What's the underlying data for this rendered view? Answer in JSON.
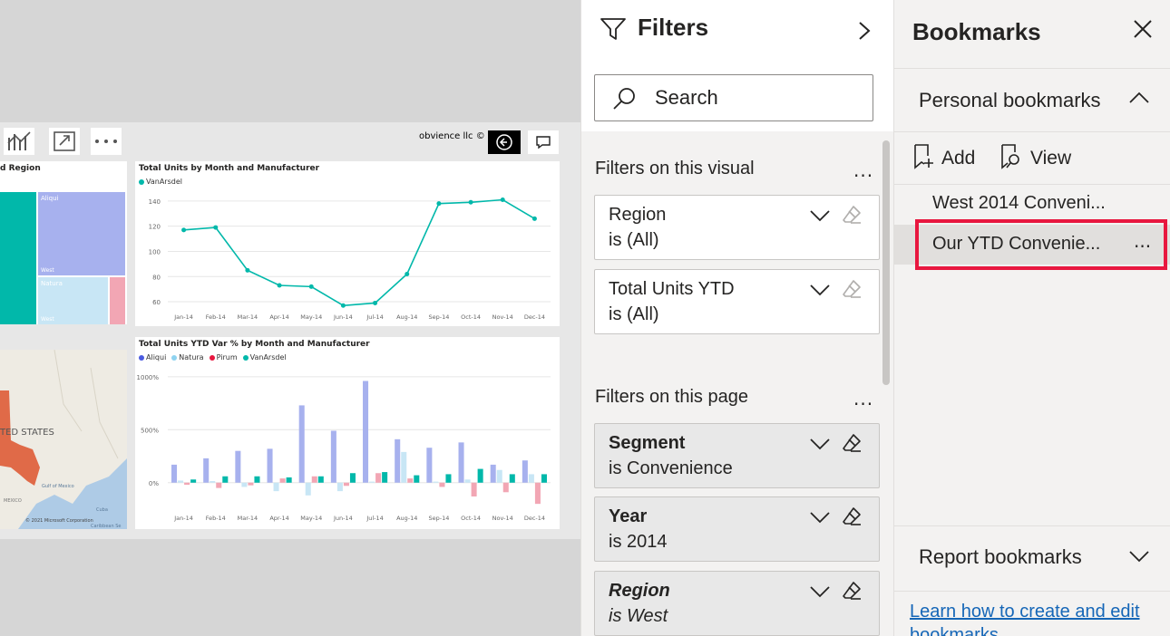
{
  "canvas": {
    "attribution": "obvience llc ©",
    "tiles": {
      "treemap_title": "d Region",
      "treemap_labels": [
        "Aliqui",
        "West",
        "Natura",
        "West"
      ],
      "map_label": "TED STATES",
      "map_copyright": "© 2021 Microsoft Corporation",
      "map_gulf": "Gulf of Mexico",
      "map_mexico": "MEXICO",
      "map_cuba": "Cuba",
      "map_caribbean": "Caribbean Se"
    }
  },
  "chart_data": [
    {
      "type": "line",
      "title": "Total Units by Month and Manufacturer",
      "categories": [
        "Jan-14",
        "Feb-14",
        "Mar-14",
        "Apr-14",
        "May-14",
        "Jun-14",
        "Jul-14",
        "Aug-14",
        "Sep-14",
        "Oct-14",
        "Nov-14",
        "Dec-14"
      ],
      "series": [
        {
          "name": "VanArsdel",
          "color": "#01b8aa",
          "values": [
            117,
            119,
            85,
            73,
            72,
            57,
            59,
            82,
            138,
            139,
            141,
            126
          ]
        }
      ],
      "yticks": [
        "60",
        "80",
        "100",
        "120",
        "140"
      ],
      "ylim": [
        55,
        150
      ]
    },
    {
      "type": "bar",
      "title": "Total Units YTD Var % by Month and Manufacturer",
      "categories": [
        "Jan-14",
        "Feb-14",
        "Mar-14",
        "Apr-14",
        "May-14",
        "Jun-14",
        "Jul-14",
        "Aug-14",
        "Sep-14",
        "Oct-14",
        "Nov-14",
        "Dec-14"
      ],
      "series": [
        {
          "name": "Aliqui",
          "color": "#a7b1ee",
          "legend_color": "#4a5ae0",
          "values": [
            170,
            230,
            300,
            320,
            730,
            490,
            960,
            410,
            330,
            380,
            170,
            210
          ]
        },
        {
          "name": "Natura",
          "color": "#c8e6f5",
          "legend_color": "#8fd3f0",
          "values": [
            20,
            15,
            -40,
            -80,
            -120,
            -80,
            10,
            290,
            10,
            30,
            120,
            80
          ]
        },
        {
          "name": "Pirum",
          "color": "#f2a6b4",
          "legend_color": "#e8173f",
          "values": [
            -20,
            -50,
            -25,
            40,
            60,
            -30,
            90,
            40,
            -40,
            -130,
            -90,
            -200
          ]
        },
        {
          "name": "VanArsdel",
          "color": "#01b8aa",
          "legend_color": "#01b8aa",
          "values": [
            30,
            60,
            60,
            50,
            60,
            90,
            100,
            70,
            80,
            130,
            80,
            80
          ]
        }
      ],
      "yticks": [
        "0%",
        "500%",
        "1000%"
      ],
      "ylim": [
        -250,
        1050
      ]
    }
  ],
  "filters": {
    "title": "Filters",
    "search_placeholder": "Search",
    "visual_section": "Filters on this visual",
    "page_section": "Filters on this page",
    "more": "...",
    "visual_filters": [
      {
        "name": "Region",
        "value": "is (All)"
      },
      {
        "name": "Total Units YTD",
        "value": "is (All)"
      }
    ],
    "page_filters": [
      {
        "name": "Segment",
        "value": "is Convenience"
      },
      {
        "name": "Year",
        "value": "is 2014"
      },
      {
        "name": "Region",
        "value": "is West"
      }
    ]
  },
  "bookmarks": {
    "title": "Bookmarks",
    "personal_label": "Personal bookmarks",
    "add_label": "Add",
    "view_label": "View",
    "items": [
      {
        "label": "West 2014 Conveni..."
      },
      {
        "label": "Our YTD Convenie...",
        "more": "..."
      }
    ],
    "report_label": "Report bookmarks",
    "learn_link": "Learn how to create and edit bookmarks"
  },
  "colors": {
    "teal": "#01b8aa",
    "highlight_red": "#e8173f",
    "link_blue": "#1566b7"
  }
}
